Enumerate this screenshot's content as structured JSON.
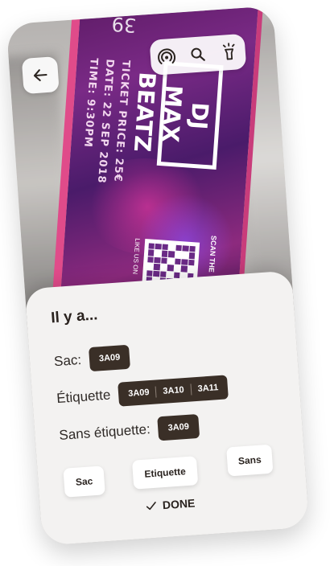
{
  "ticket": {
    "number": "39",
    "lines": [
      "TICKET PRICE: 25€",
      "DATE: 22 SEP 2018",
      "TIME: 9:30PM"
    ],
    "logo": "DJ MAX BEATZ",
    "scan_text": "SCAN THE",
    "like_text": "LIKE US ON"
  },
  "toolbar": {
    "back_icon": "arrow-left-icon",
    "tools": [
      "nfc-icon",
      "search-icon",
      "flashlight-icon"
    ]
  },
  "sheet": {
    "title": "Il y a...",
    "rows": [
      {
        "label": "Sac:",
        "tags": [
          "3A09"
        ]
      },
      {
        "label": "Étiquette",
        "tags": [
          "3A09",
          "3A10",
          "3A11"
        ]
      },
      {
        "label": "Sans étiquette:",
        "tags": [
          "3A09"
        ]
      }
    ],
    "chips": [
      "Sac",
      "Etiquette",
      "Sans"
    ],
    "done_label": "DONE"
  },
  "colors": {
    "sheet_bg": "#f3f2f1",
    "tag_bg": "#3a2f27",
    "ticket_accent": "#e04b8a"
  }
}
